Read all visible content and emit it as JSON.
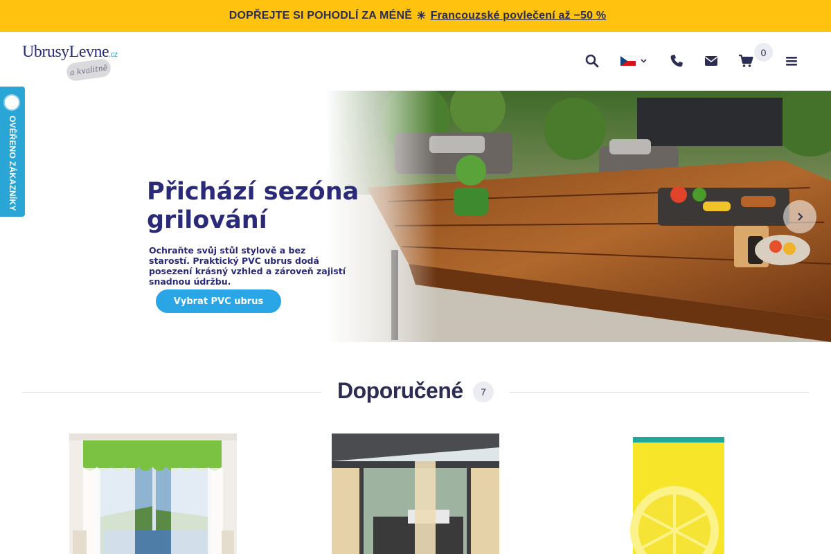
{
  "promo": {
    "icon": "",
    "text": "DOPŘEJTE SI POHODLÍ ZA MÉNĚ",
    "sun": "☀",
    "link": "Francouzské povlečení až −50 %"
  },
  "header": {
    "logo_main": "UbrusyLevne",
    "logo_cz": ".cz",
    "logo_tag": "a kvalitně",
    "cart_count": "0",
    "icons": [
      "search-icon",
      "czech-flag-icon",
      "phone-icon",
      "envelope-icon",
      "cart-icon",
      "menu-icon"
    ]
  },
  "side_widget": {
    "label": "OVĚŘENO ZÁKAZNÍKY"
  },
  "hero": {
    "title": "Přichází sezóna grilování",
    "subtitle": "Ochraňte svůj stůl stylově a bez starostí. Praktický PVC ubrus dodá posezení krásný vzhled a zároveň zajistí snadnou údržbu.",
    "button": "Vybrat PVC ubrus"
  },
  "recommended": {
    "title": "Doporučené",
    "count": "7"
  },
  "colors": {
    "promo": "#ffc20e",
    "accent": "#2aa6e6",
    "navy": "#2b2a78",
    "text": "#2b2d52"
  }
}
